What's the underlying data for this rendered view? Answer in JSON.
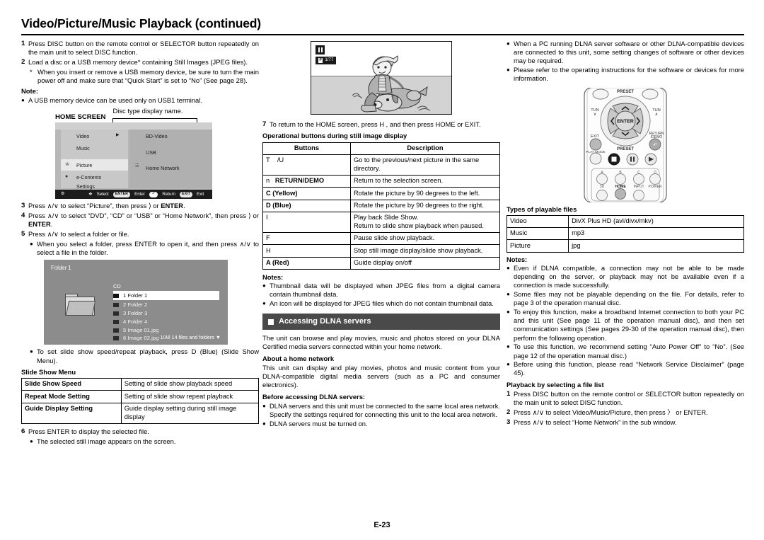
{
  "page": {
    "title": "Video/Picture/Music Playback (continued)",
    "footer": "E-23"
  },
  "column1": {
    "steps": [
      {
        "num": "1",
        "text": "Press DISC button on the remote control or SELECTOR button repeatedly on the main unit to select DISC function."
      },
      {
        "num": "2",
        "text": "Load a disc or a USB memory device* containing Still Images (JPEG files)."
      }
    ],
    "step2_substar": "When you insert or remove a USB memory device, be sure to turn the main power off and make sure that “Quick Start” is set to “No” (See page 28).",
    "note_label": "Note:",
    "note_bullet": "A USB memory device can be used only on USB1 terminal.",
    "home_screen_label": "HOME SCREEN",
    "disc_type_caption": "Disc type display name.",
    "home_screen": {
      "left_items": [
        "Video",
        "Music",
        "Picture",
        "e-Contents",
        "Settings"
      ],
      "right_items": [
        "BD-Video",
        "USB",
        "Home Network"
      ],
      "selected_left": "Picture",
      "guide": [
        {
          "key": "",
          "label": ""
        },
        {
          "key": "",
          "label": "Select"
        },
        {
          "key": "ENTER",
          "label": "Enter"
        },
        {
          "key": "",
          "label": "Return"
        },
        {
          "key": "EXIT",
          "label": "Exit"
        }
      ]
    },
    "steps2": [
      {
        "num": "3",
        "text_a": "Press ",
        "text_b": " to select “Picture”, then press ",
        "text_c": " or ",
        "bold": "ENTER",
        "tail": "."
      },
      {
        "num": "4",
        "text_a": "Press ",
        "text_b": " to select “DVD”, “CD” or “USB” or “Home Network”, then press ",
        "text_c": " or ",
        "bold": "ENTER",
        "tail": "."
      },
      {
        "num": "5",
        "text_a": "Press ",
        "text_b": " to select a folder or file.",
        "text_c": "",
        "bold": "",
        "tail": ""
      }
    ],
    "step5_bullet": "When you select a folder, press ENTER to open it, and then press ∧/∨ to select a file in the folder.",
    "folder_screen": {
      "title": "Folder 1",
      "source": "CD",
      "files": [
        {
          "name": "1 Folder 1",
          "type": "folder",
          "selected": true
        },
        {
          "name": "2 Folder 2",
          "type": "folder",
          "selected": false
        },
        {
          "name": "3 Folder 3",
          "type": "folder",
          "selected": false
        },
        {
          "name": "4 Folder 4",
          "type": "folder",
          "selected": false
        },
        {
          "name": "5 Image 01.jpg",
          "type": "file",
          "selected": false
        },
        {
          "name": "6 Image 02.jpg",
          "type": "file",
          "selected": false
        }
      ],
      "footer": "1/All 14 files and folders"
    },
    "slide_bullet": "To set slide show speed/repeat playback, press D (Blue) (Slide Show Menu).",
    "slide_menu_title": "Slide Show Menu",
    "slide_menu_rows": [
      {
        "key": "Slide Show Speed",
        "value": "Setting of slide show playback speed"
      },
      {
        "key": "Repeat Mode Setting",
        "value": "Setting of slide show repeat playback"
      },
      {
        "key": "Guide Display Setting",
        "value": "Guide display setting during still image display"
      }
    ],
    "step6": {
      "num": "6",
      "text": "Press ENTER to display the selected file."
    },
    "step6_bullet": "The selected still image appears on the screen."
  },
  "column2": {
    "still_image": {
      "counter": "1/77",
      "badge": "P"
    },
    "step7": {
      "num": "7",
      "text": "To return to the HOME screen, press H , and then press HOME or EXIT."
    },
    "buttons_title": "Operational buttons during still image display",
    "buttons_table": {
      "headers": [
        "Buttons",
        "Description"
      ],
      "rows": [
        {
          "button": "T    /U",
          "desc": "Go to the previous/next picture in the same directory."
        },
        {
          "button": "n    RETURN/DEMO",
          "desc": "Return to the selection screen."
        },
        {
          "button": "C (Yellow)",
          "desc": "Rotate the picture by 90 degrees to the left."
        },
        {
          "button": "D (Blue)",
          "desc": "Rotate the picture by 90 degrees to the right."
        },
        {
          "button": "I",
          "desc": "Play back Slide Show.\nReturn to slide show playback when paused."
        },
        {
          "button": "F",
          "desc": "Pause slide show playback."
        },
        {
          "button": "H",
          "desc": "Stop still image display/slide show playback."
        },
        {
          "button": "A (Red)",
          "desc": "Guide display on/off"
        }
      ]
    },
    "notes_label": "Notes:",
    "notes": [
      "Thumbnail data will be displayed when JPEG files from a digital camera contain thumbnail data.",
      "An icon will be displayed for JPEG files which do not contain thumbnail data."
    ],
    "section_title": "Accessing DLNA servers",
    "intro": "The unit can browse and play movies, music and photos stored on your DLNA Certified media servers connected within your home network.",
    "home_network_title": "About a home network",
    "home_network_text": "This unit can display and play movies, photos and music content from your DLNA-compatible digital media servers (such as a PC and consumer electronics).",
    "before_title": "Before accessing DLNA servers:",
    "before_bullets": [
      "DLNA servers and this unit must be connected to the same local area network. Specify the settings required for connecting this unit to the local area network.",
      "DLNA servers must be turned on."
    ]
  },
  "column3": {
    "top_bullets": [
      "When a PC running DLNA server software or other DLNA-compatible devices are connected to this unit, some setting changes of software or other devices may be required.",
      "Please refer to the operating instructions for the software or devices for more information."
    ],
    "remote": {
      "preset_top": "PRESET",
      "preset_bottom": "PRESET",
      "enter": "ENTER",
      "tune_left": "TUN",
      "tune_right": "TUN",
      "exit": "EXIT",
      "return_demo": "RETURN /DEMO",
      "play_mode": "PLAY MODE",
      "color_a": "A",
      "color_b": "B",
      "color_c": "C",
      "color_d": "D",
      "label_3d": "3D",
      "label_home": "HOME",
      "label_input": "INPUT",
      "label_power": "POWER"
    },
    "playable_title": "Types of playable files",
    "playable_rows": [
      {
        "key": "Video",
        "value": "DivX Plus HD (avi/divx/mkv)"
      },
      {
        "key": "Music",
        "value": "mp3"
      },
      {
        "key": "Picture",
        "value": "jpg"
      }
    ],
    "notes_label": "Notes:",
    "notes": [
      "Even if DLNA compatible, a connection may not be able to be made depending on the server, or playback may not be available even if a connection is made successfully.",
      "Some files may not be playable depending on the file. For details, refer to page 3 of the operation manual disc.",
      "To enjoy this function, make a broadband Internet connection to both your PC and this unit (See page 11 of the operation manual disc), and then set communication settings (See pages 29-30 of the operation manual disc), then perform the following operation.",
      "To use this function, we recommend setting “Auto Power Off” to “No”. (See page 12 of the operation manual disc.)",
      "Before using this function, please read “Network Service Disclaimer” (page 45)."
    ],
    "playback_title": "Playback by selecting a file list",
    "playback_steps": [
      {
        "num": "1",
        "text": "Press DISC button on the remote control or SELECTOR button repeatedly on the main unit to select DISC function."
      },
      {
        "num": "2",
        "text": "Press ∧/∨ to select Video/Music/Picture, then press 〉 or ENTER."
      },
      {
        "num": "3",
        "text": "Press ∧/∨ to select “Home Network” in the sub window."
      }
    ]
  }
}
